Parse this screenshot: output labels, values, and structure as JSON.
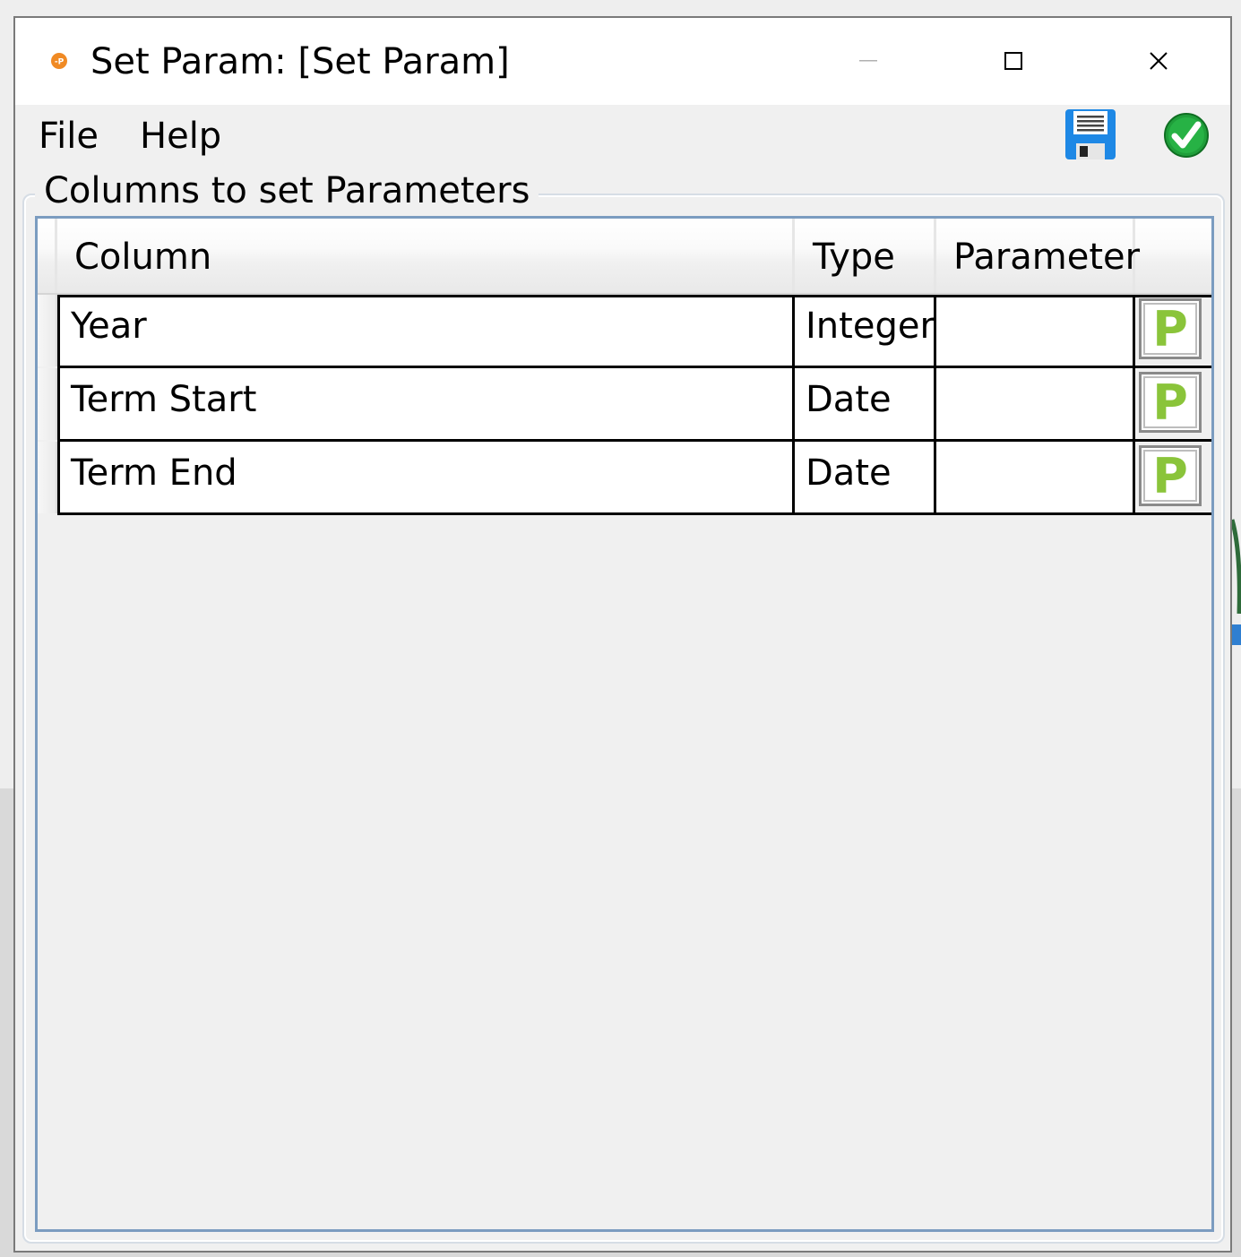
{
  "window": {
    "title": "Set Param: [Set Param]"
  },
  "menu": {
    "items": [
      {
        "label": "File"
      },
      {
        "label": "Help"
      }
    ]
  },
  "toolbar": {
    "save_icon": "floppy-disk-icon",
    "ok_icon": "green-checkmark-icon"
  },
  "group": {
    "title": "Columns to set Parameters"
  },
  "grid": {
    "headers": {
      "column": "Column",
      "type": "Type",
      "parameter": "Parameter",
      "action": ""
    },
    "rows": [
      {
        "column": "Year",
        "type": "Integer",
        "parameter": "",
        "button": "P"
      },
      {
        "column": "Term Start",
        "type": "Date",
        "parameter": "",
        "button": "P"
      },
      {
        "column": "Term End",
        "type": "Date",
        "parameter": "",
        "button": "P"
      }
    ]
  },
  "colors": {
    "p_button": "#8ac43a",
    "grid_border": "#7b9cc0",
    "save_icon_blue": "#1e88e5",
    "ok_green": "#1f9e3a"
  }
}
